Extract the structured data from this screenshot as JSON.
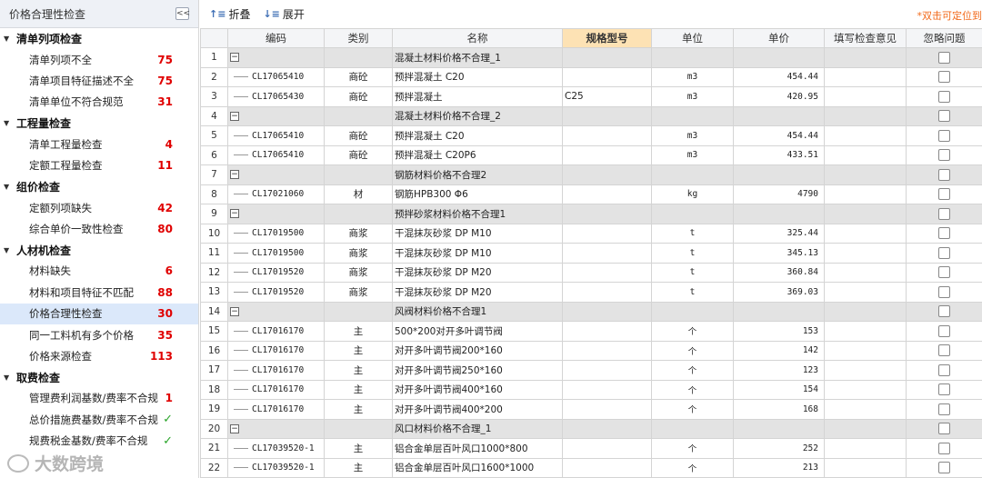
{
  "sidebar": {
    "title": "价格合理性检查",
    "collapse_label": "<<",
    "groups": [
      {
        "label": "清单列项检查",
        "items": [
          {
            "label": "清单列项不全",
            "count": "75"
          },
          {
            "label": "清单项目特征描述不全",
            "count": "75"
          },
          {
            "label": "清单单位不符合规范",
            "count": "31"
          }
        ]
      },
      {
        "label": "工程量检查",
        "items": [
          {
            "label": "清单工程量检查",
            "count": "4"
          },
          {
            "label": "定额工程量检查",
            "count": "11"
          }
        ]
      },
      {
        "label": "组价检查",
        "items": [
          {
            "label": "定额列项缺失",
            "count": "42"
          },
          {
            "label": "综合单价一致性检查",
            "count": "80"
          }
        ]
      },
      {
        "label": "人材机检查",
        "items": [
          {
            "label": "材料缺失",
            "count": "6"
          },
          {
            "label": "材料和项目特征不匹配",
            "count": "88"
          },
          {
            "label": "价格合理性检查",
            "count": "30",
            "active": true
          },
          {
            "label": "同一工料机有多个价格",
            "count": "35"
          },
          {
            "label": "价格来源检查",
            "count": "113"
          }
        ]
      },
      {
        "label": "取费检查",
        "items": [
          {
            "label": "管理费利润基数/费率不合规",
            "count": "1"
          },
          {
            "label": "总价措施费基数/费率不合规",
            "check": "✓"
          },
          {
            "label": "规费税金基数/费率不合规",
            "check": "✓"
          }
        ]
      }
    ],
    "watermark": "大数跨境"
  },
  "toolbar": {
    "fold_label": "折叠",
    "expand_label": "展开",
    "hint": "*双击可定位到"
  },
  "table": {
    "columns": [
      "",
      "编码",
      "类别",
      "名称",
      "规格型号",
      "单位",
      "单价",
      "填写检查意见",
      "忽略问题"
    ],
    "rows": [
      {
        "no": "1",
        "group": true,
        "name": "混凝土材料价格不合理_1"
      },
      {
        "no": "2",
        "code": "CL17065410",
        "cat": "商砼",
        "name": "预拌混凝土 C20",
        "spec": "",
        "unit": "m3",
        "price": "454.44"
      },
      {
        "no": "3",
        "code": "CL17065430",
        "cat": "商砼",
        "name": "预拌混凝土",
        "spec": "C25",
        "unit": "m3",
        "price": "420.95"
      },
      {
        "no": "4",
        "group": true,
        "name": "混凝土材料价格不合理_2"
      },
      {
        "no": "5",
        "code": "CL17065410",
        "cat": "商砼",
        "name": "预拌混凝土 C20",
        "spec": "",
        "unit": "m3",
        "price": "454.44"
      },
      {
        "no": "6",
        "code": "CL17065410",
        "cat": "商砼",
        "name": "预拌混凝土 C20P6",
        "spec": "",
        "unit": "m3",
        "price": "433.51"
      },
      {
        "no": "7",
        "group": true,
        "name": "钢筋材料价格不合理2"
      },
      {
        "no": "8",
        "code": "CL17021060",
        "cat": "材",
        "name": "钢筋HPB300 Φ6",
        "spec": "",
        "unit": "kg",
        "price": "4790"
      },
      {
        "no": "9",
        "group": true,
        "name": "预拌砂浆材料价格不合理1"
      },
      {
        "no": "10",
        "code": "CL17019500",
        "cat": "商浆",
        "name": "干混抹灰砂浆 DP M10",
        "spec": "",
        "unit": "t",
        "price": "325.44"
      },
      {
        "no": "11",
        "code": "CL17019500",
        "cat": "商浆",
        "name": "干混抹灰砂浆 DP M10",
        "spec": "",
        "unit": "t",
        "price": "345.13"
      },
      {
        "no": "12",
        "code": "CL17019520",
        "cat": "商浆",
        "name": "干混抹灰砂浆 DP M20",
        "spec": "",
        "unit": "t",
        "price": "360.84"
      },
      {
        "no": "13",
        "code": "CL17019520",
        "cat": "商浆",
        "name": "干混抹灰砂浆 DP M20",
        "spec": "",
        "unit": "t",
        "price": "369.03"
      },
      {
        "no": "14",
        "group": true,
        "name": "风阀材料价格不合理1"
      },
      {
        "no": "15",
        "code": "CL17016170",
        "cat": "主",
        "name": "500*200对开多叶调节阀",
        "spec": "",
        "unit": "个",
        "price": "153"
      },
      {
        "no": "16",
        "code": "CL17016170",
        "cat": "主",
        "name": "对开多叶调节阀200*160",
        "spec": "",
        "unit": "个",
        "price": "142"
      },
      {
        "no": "17",
        "code": "CL17016170",
        "cat": "主",
        "name": "对开多叶调节阀250*160",
        "spec": "",
        "unit": "个",
        "price": "123"
      },
      {
        "no": "18",
        "code": "CL17016170",
        "cat": "主",
        "name": "对开多叶调节阀400*160",
        "spec": "",
        "unit": "个",
        "price": "154"
      },
      {
        "no": "19",
        "code": "CL17016170",
        "cat": "主",
        "name": "对开多叶调节阀400*200",
        "spec": "",
        "unit": "个",
        "price": "168"
      },
      {
        "no": "20",
        "group": true,
        "name": "风口材料价格不合理_1"
      },
      {
        "no": "21",
        "code": "CL17039520-1",
        "cat": "主",
        "name": "铝合金单层百叶风口1000*800",
        "spec": "",
        "unit": "个",
        "price": "252"
      },
      {
        "no": "22",
        "code": "CL17039520-1",
        "cat": "主",
        "name": "铝合金单层百叶风口1600*1000",
        "spec": "",
        "unit": "个",
        "price": "213"
      }
    ]
  }
}
